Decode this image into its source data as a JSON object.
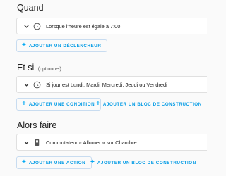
{
  "triggers": {
    "title": "Quand",
    "items": [
      {
        "icon": "clock-icon",
        "text": "Lorsque l'heure est égale à 7:00"
      }
    ],
    "add_trigger_label": "AJOUTER UN DÉCLENCHEUR"
  },
  "conditions": {
    "title": "Et si",
    "optional_label": "(optionnel)",
    "items": [
      {
        "icon": "clock-icon",
        "text": "Si jour est Lundi, Mardi, Mercredi, Jeudi ou Vendredi"
      }
    ],
    "add_condition_label": "AJOUTER UNE CONDITION",
    "add_block_label": "AJOUTER UN BLOC DE CONSTRUCTION"
  },
  "actions": {
    "title": "Alors faire",
    "items": [
      {
        "icon": "switch-icon",
        "text": "Commutateur « Allumer » sur Chambre"
      }
    ],
    "add_action_label": "AJOUTER UNE ACTION",
    "add_block_label": "AJOUTER UN BLOC DE CONSTRUCTION"
  },
  "colors": {
    "accent": "#03a9f4",
    "background": "#fafafa",
    "card": "#ffffff",
    "border": "#e0e0e0"
  }
}
